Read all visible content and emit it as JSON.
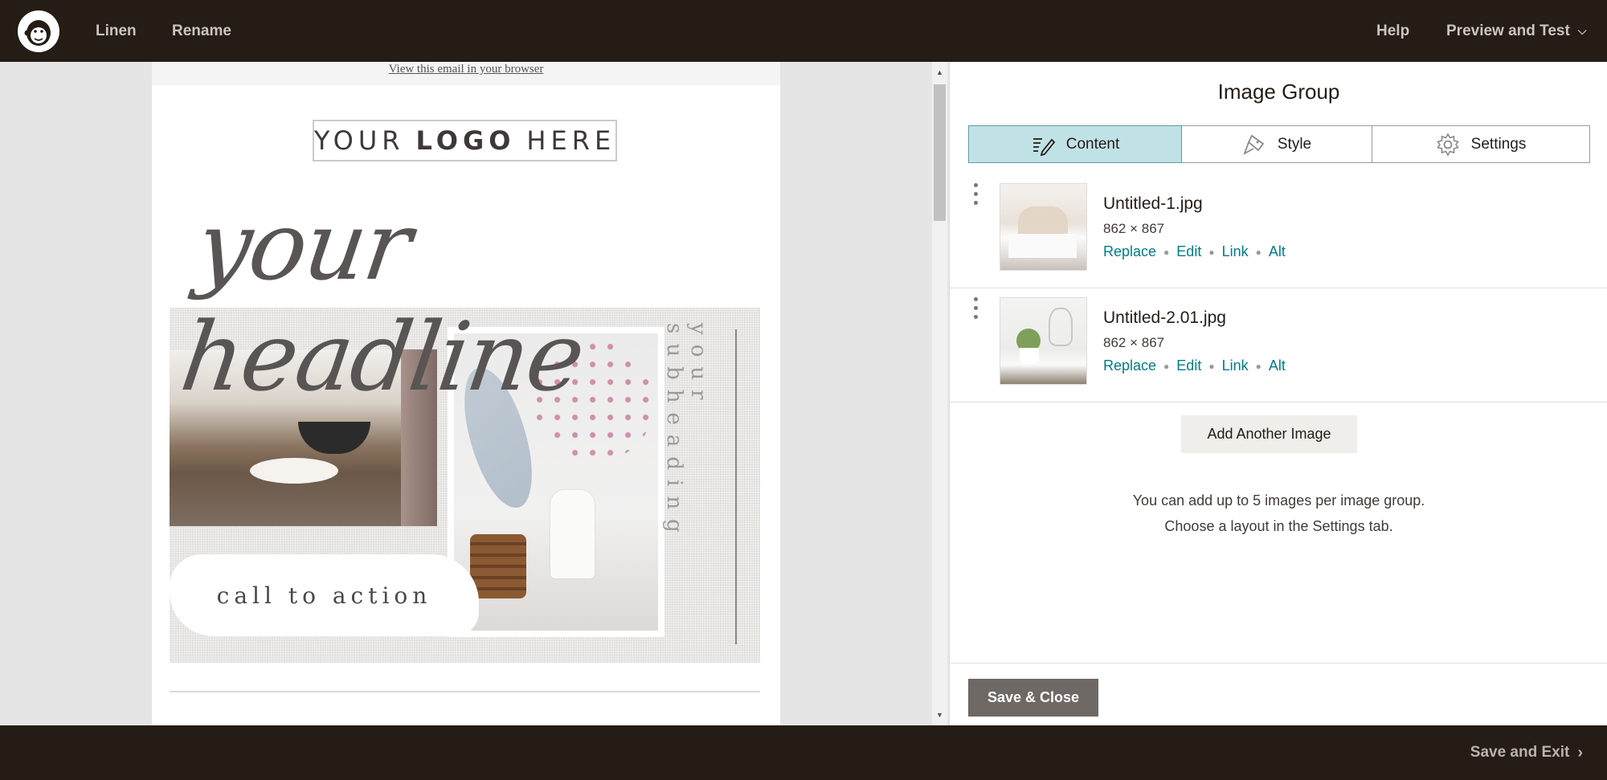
{
  "topbar": {
    "logo_icon": "mailchimp-freddie-icon",
    "nav": [
      {
        "label": "Linen"
      },
      {
        "label": "Rename"
      }
    ],
    "help_label": "Help",
    "preview_label": "Preview and Test"
  },
  "email": {
    "view_in_browser": "View this email in your browser",
    "logo_text_pre": "YOUR",
    "logo_text_bold": "LOGO",
    "logo_text_post": "HERE",
    "headline": "your headline",
    "subheading": "your subheading",
    "cta": "call to action"
  },
  "panel": {
    "title": "Image Group",
    "tabs": [
      {
        "label": "Content",
        "icon": "pencil-lines-icon",
        "active": true
      },
      {
        "label": "Style",
        "icon": "paint-brush-icon",
        "active": false
      },
      {
        "label": "Settings",
        "icon": "gear-icon",
        "active": false
      }
    ],
    "images": [
      {
        "name": "Untitled-1.jpg",
        "dims": "862 × 867"
      },
      {
        "name": "Untitled-2.01.jpg",
        "dims": "862 × 867"
      }
    ],
    "actions": {
      "replace": "Replace",
      "edit": "Edit",
      "link": "Link",
      "alt": "Alt"
    },
    "add_button": "Add Another Image",
    "hint_line1": "You can add up to 5 images per image group.",
    "hint_line2": "Choose a layout in the Settings tab.",
    "save_close": "Save & Close"
  },
  "bottombar": {
    "save_exit": "Save and Exit"
  },
  "colors": {
    "topbar_bg": "#241c15",
    "accent_link": "#007c89",
    "active_tab": "#c0e2e6",
    "save_close_bg": "#6e6965"
  }
}
